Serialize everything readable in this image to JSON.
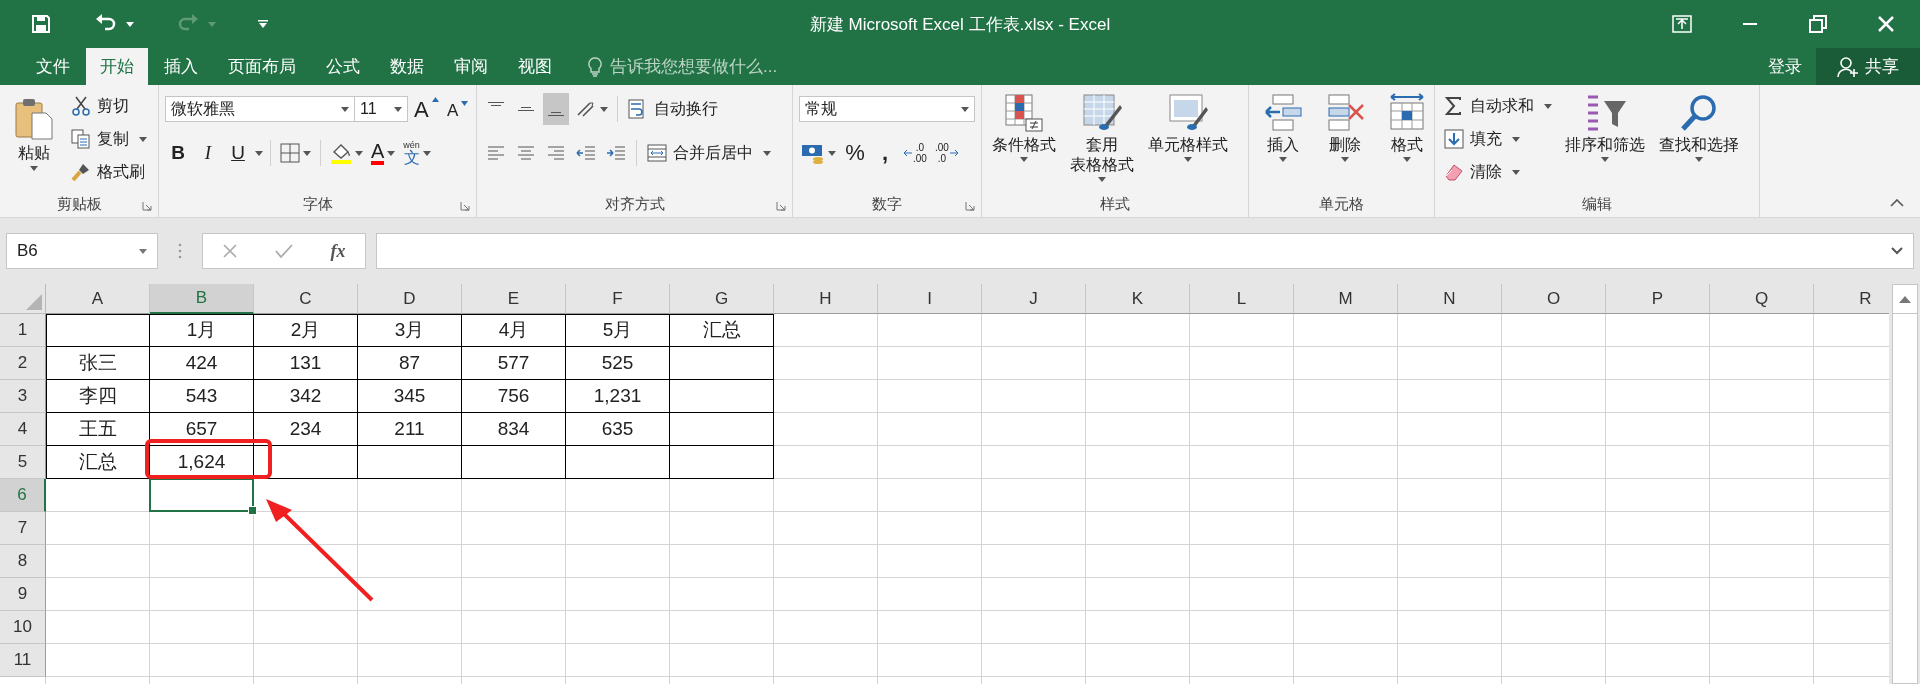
{
  "window": {
    "title": "新建 Microsoft Excel 工作表.xlsx - Excel"
  },
  "quick_access": [
    {
      "kind": "save",
      "disabled": false
    },
    {
      "kind": "undo",
      "disabled": false
    },
    {
      "kind": "redo",
      "disabled": true
    },
    {
      "kind": "customize",
      "disabled": false
    }
  ],
  "window_controls": [
    {
      "kind": "ribbon-display"
    },
    {
      "kind": "minimize"
    },
    {
      "kind": "restore"
    },
    {
      "kind": "close"
    }
  ],
  "tabs": [
    {
      "label": "文件",
      "selected": false
    },
    {
      "label": "开始",
      "selected": true
    },
    {
      "label": "插入",
      "selected": false
    },
    {
      "label": "页面布局",
      "selected": false
    },
    {
      "label": "公式",
      "selected": false
    },
    {
      "label": "数据",
      "selected": false
    },
    {
      "label": "审阅",
      "selected": false
    },
    {
      "label": "视图",
      "selected": false
    }
  ],
  "tell_me": {
    "placeholder": "告诉我您想要做什么..."
  },
  "account": {
    "sign_in": "登录",
    "share": "共享"
  },
  "ribbon": {
    "clipboard": {
      "label": "剪贴板",
      "launcher": true,
      "paste": "粘贴",
      "items": [
        {
          "kind": "cut",
          "label": "剪切"
        },
        {
          "kind": "copy",
          "label": "复制",
          "dropdown": true
        },
        {
          "kind": "format-painter",
          "label": "格式刷"
        }
      ]
    },
    "font": {
      "label": "字体",
      "launcher": true,
      "font_name": "微软雅黑",
      "font_size": "11",
      "grow": "A",
      "shrink": "A",
      "bold": "B",
      "italic": "I",
      "underline": "U",
      "font_color": "A",
      "phonetic": "wén",
      "phonetic_char": "文"
    },
    "alignment": {
      "label": "对齐方式",
      "launcher": true,
      "vertical": [
        {
          "kind": "top",
          "selected": false
        },
        {
          "kind": "middle",
          "selected": false
        },
        {
          "kind": "bottom",
          "selected": true
        }
      ],
      "horizontal": [
        {
          "kind": "left",
          "selected": false
        },
        {
          "kind": "center",
          "selected": false
        },
        {
          "kind": "right",
          "selected": false
        }
      ],
      "wrap": "自动换行",
      "merge": "合并后居中"
    },
    "number": {
      "label": "数字",
      "launcher": true,
      "format": "常规",
      "percent": "%",
      "comma": ",",
      "increase_decimal": [
        ".0",
        ".00"
      ],
      "decrease_decimal": [
        ".00",
        ".0"
      ]
    },
    "styles": {
      "label": "样式",
      "items": [
        {
          "kind": "conditional",
          "lines": [
            "条件格式"
          ]
        },
        {
          "kind": "table",
          "lines": [
            "套用",
            "表格格式"
          ]
        },
        {
          "kind": "cell-style",
          "lines": [
            "单元格样式"
          ]
        }
      ]
    },
    "cells": {
      "label": "单元格",
      "items": [
        {
          "kind": "insert",
          "label": "插入"
        },
        {
          "kind": "delete",
          "label": "删除"
        },
        {
          "kind": "format",
          "label": "格式"
        }
      ]
    },
    "editing": {
      "label": "编辑",
      "small": [
        {
          "kind": "autosum",
          "label": "自动求和"
        },
        {
          "kind": "fill",
          "label": "填充"
        },
        {
          "kind": "clear",
          "label": "清除"
        }
      ],
      "large": [
        {
          "kind": "sort",
          "label": "排序和筛选"
        },
        {
          "kind": "find",
          "label": "查找和选择"
        }
      ]
    }
  },
  "formula_bar": {
    "name_box": "B6",
    "fx": "fx"
  },
  "grid": {
    "columns": [
      {
        "label": "A",
        "selected": false
      },
      {
        "label": "B",
        "selected": true
      },
      {
        "label": "C",
        "selected": false
      },
      {
        "label": "D",
        "selected": false
      },
      {
        "label": "E",
        "selected": false
      },
      {
        "label": "F",
        "selected": false
      },
      {
        "label": "G",
        "selected": false
      },
      {
        "label": "H",
        "selected": false
      },
      {
        "label": "I",
        "selected": false
      },
      {
        "label": "J",
        "selected": false
      },
      {
        "label": "K",
        "selected": false
      },
      {
        "label": "L",
        "selected": false
      },
      {
        "label": "M",
        "selected": false
      },
      {
        "label": "N",
        "selected": false
      },
      {
        "label": "O",
        "selected": false
      },
      {
        "label": "P",
        "selected": false
      },
      {
        "label": "Q",
        "selected": false
      },
      {
        "label": "R",
        "selected": false
      }
    ],
    "rows": [
      {
        "header": "1",
        "selected": false,
        "cells": [
          "",
          "1月",
          "2月",
          "3月",
          "4月",
          "5月",
          "汇总"
        ]
      },
      {
        "header": "2",
        "selected": false,
        "cells": [
          "张三",
          "424",
          "131",
          "87",
          "577",
          "525",
          ""
        ]
      },
      {
        "header": "3",
        "selected": false,
        "cells": [
          "李四",
          "543",
          "342",
          "345",
          "756",
          "1,231",
          ""
        ]
      },
      {
        "header": "4",
        "selected": false,
        "cells": [
          "王五",
          "657",
          "234",
          "211",
          "834",
          "635",
          ""
        ]
      },
      {
        "header": "5",
        "selected": false,
        "cells": [
          "汇总",
          "1,624",
          "",
          "",
          "",
          "",
          ""
        ]
      },
      {
        "header": "6",
        "selected": true
      },
      {
        "header": "7",
        "selected": false
      },
      {
        "header": "8",
        "selected": false
      },
      {
        "header": "9",
        "selected": false
      },
      {
        "header": "10",
        "selected": false
      },
      {
        "header": "11",
        "selected": false
      }
    ]
  },
  "annotations": {
    "highlight_box": true,
    "pointer_arrow": true
  }
}
